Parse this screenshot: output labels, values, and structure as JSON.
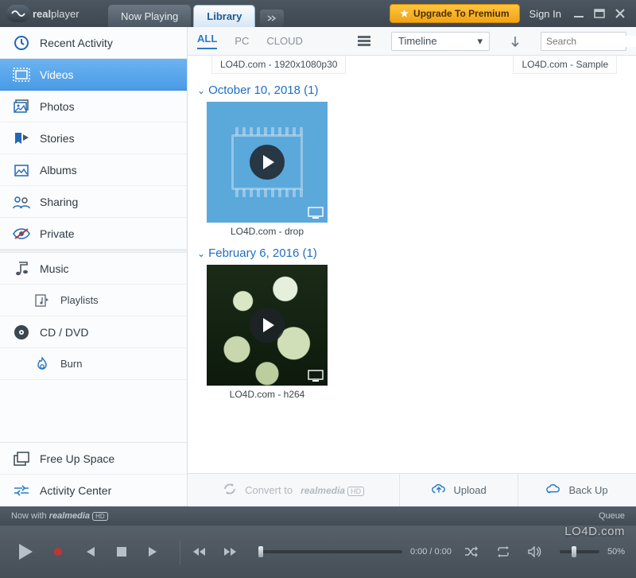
{
  "titlebar": {
    "logo_brand_a": "real",
    "logo_brand_b": "player",
    "tab_now_playing": "Now Playing",
    "tab_library": "Library",
    "upgrade_label": "Upgrade To Premium",
    "signin": "Sign In"
  },
  "sidebar": {
    "recent": "Recent Activity",
    "videos": "Videos",
    "photos": "Photos",
    "stories": "Stories",
    "albums": "Albums",
    "sharing": "Sharing",
    "private": "Private",
    "music": "Music",
    "playlists": "Playlists",
    "cddvd": "CD / DVD",
    "burn": "Burn",
    "free_space": "Free Up Space",
    "activity_center": "Activity Center"
  },
  "filterbar": {
    "all": "ALL",
    "pc": "PC",
    "cloud": "CLOUD",
    "sort_mode": "Timeline",
    "search_placeholder": "Search"
  },
  "content": {
    "prev1": "LO4D.com - 1920x1080p30",
    "prev2": "LO4D.com - Sample",
    "group1_title": "October 10, 2018 (1)",
    "group1_item1": "LO4D.com - drop",
    "group2_title": "February 6, 2016 (1)",
    "group2_item1": "LO4D.com - h264"
  },
  "actionbar": {
    "convert": "Convert to",
    "realmedia": "realmedia",
    "hd": "HD",
    "upload": "Upload",
    "backup": "Back Up"
  },
  "nowwith": {
    "prefix": "Now with",
    "brand": "realmedia",
    "hd": "HD",
    "queue": "Queue"
  },
  "player": {
    "time": "0:00 / 0:00",
    "vol_pct": "50%"
  },
  "watermark": "LO4D.com"
}
